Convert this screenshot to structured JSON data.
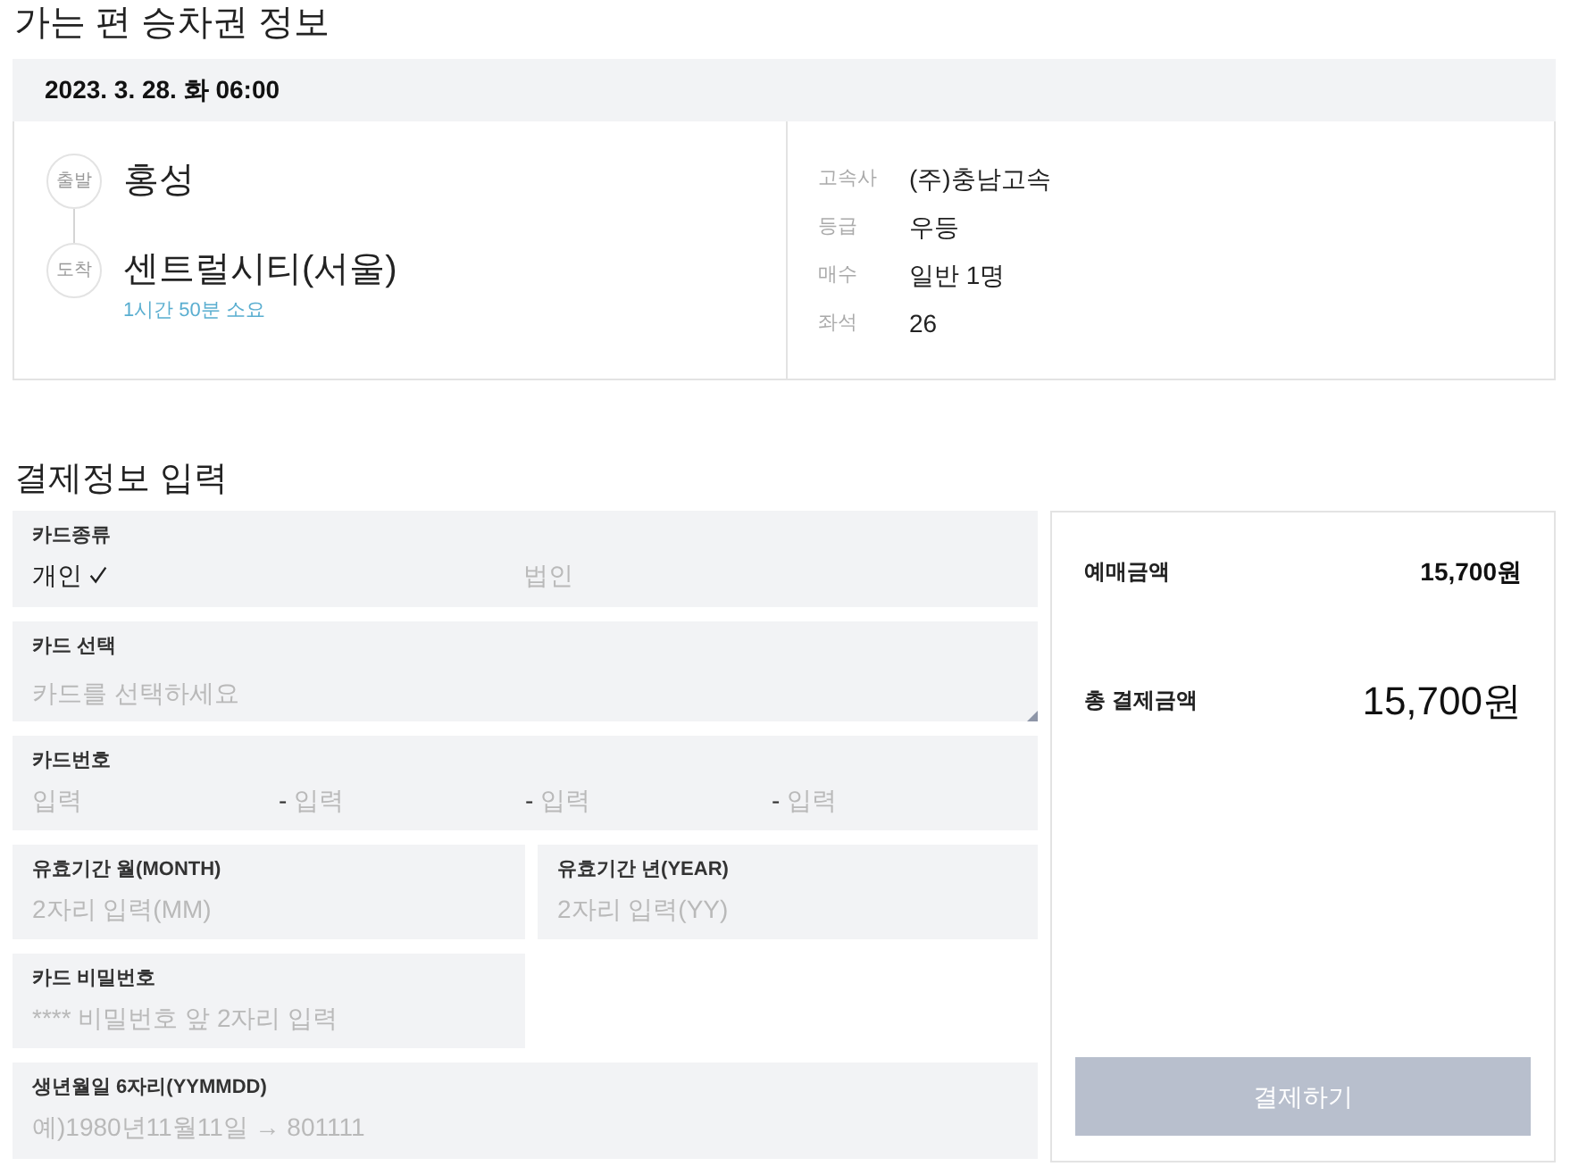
{
  "ticket": {
    "title": "가는 편 승차권 정보",
    "datetime": "2023. 3. 28. 화 06:00",
    "departure": {
      "marker": "출발",
      "station": "홍성"
    },
    "arrival": {
      "marker": "도착",
      "station": "센트럴시티(서울)",
      "duration": "1시간 50분 소요"
    },
    "details": [
      {
        "label": "고속사",
        "value": "(주)충남고속"
      },
      {
        "label": "등급",
        "value": "우등"
      },
      {
        "label": "매수",
        "value": "일반 1명"
      },
      {
        "label": "좌석",
        "value": "26"
      }
    ]
  },
  "payment": {
    "title": "결제정보 입력",
    "fields": [
      {
        "kind": "choice",
        "label": "카드종류",
        "options": [
          {
            "label": "개인",
            "selected": true
          },
          {
            "label": "법인",
            "selected": false
          }
        ]
      },
      {
        "kind": "select",
        "label": "카드 선택",
        "placeholder": "카드를 선택하세요"
      },
      {
        "kind": "card_number",
        "label": "카드번호",
        "parts": [
          {
            "placeholder": "입력"
          },
          {
            "prefix": "-",
            "placeholder": "입력"
          },
          {
            "prefix": "-",
            "placeholder": "입력"
          },
          {
            "prefix": "-",
            "placeholder": "입력"
          }
        ]
      },
      {
        "kind": "short",
        "label": "유효기간 월(MONTH)",
        "placeholder": "2자리 입력(MM)"
      },
      {
        "kind": "short",
        "label": "유효기간 년(YEAR)",
        "placeholder": "2자리 입력(YY)"
      },
      {
        "kind": "short",
        "label": "카드 비밀번호",
        "placeholder": "**** 비밀번호 앞 2자리 입력"
      },
      {
        "kind": "wide",
        "label": "생년월일 6자리(YYMMDD)",
        "placeholder": "예)1980년11월11일 → 801111"
      }
    ]
  },
  "summary": {
    "rows": [
      {
        "kind": "subtotal",
        "label": "예매금액",
        "value": "15,700원"
      },
      {
        "kind": "total",
        "label": "총 결제금액",
        "value": "15,700원"
      }
    ],
    "button": {
      "label": "결제하기",
      "disabled": true
    }
  }
}
